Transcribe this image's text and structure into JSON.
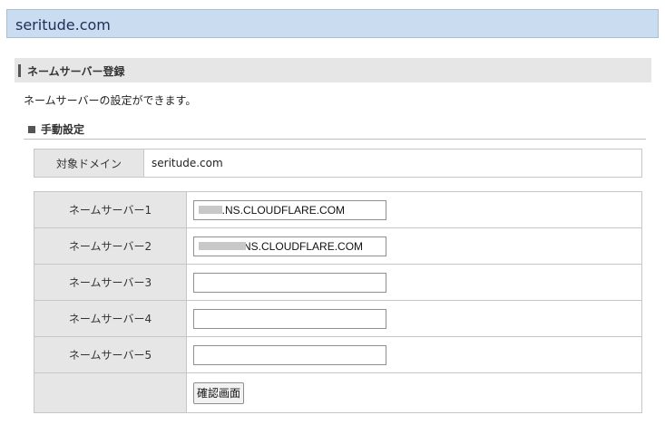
{
  "header": {
    "title": "seritude.com"
  },
  "section": {
    "title": "ネームサーバー登録",
    "description": "ネームサーバーの設定ができます。",
    "subheading": "手動設定"
  },
  "domain_table": {
    "label": "対象ドメイン",
    "value": "seritude.com"
  },
  "nameservers": [
    {
      "label": "ネームサーバー1",
      "value": "        .NS.CLOUDFLARE.COM"
    },
    {
      "label": "ネームサーバー2",
      "value": "               NS.CLOUDFLARE.COM"
    },
    {
      "label": "ネームサーバー3",
      "value": ""
    },
    {
      "label": "ネームサーバー4",
      "value": ""
    },
    {
      "label": "ネームサーバー5",
      "value": ""
    }
  ],
  "confirm_button": {
    "label": "確認画面"
  },
  "colors": {
    "header_bg": "#c9dcf0",
    "label_bg": "#e6e6e6"
  }
}
